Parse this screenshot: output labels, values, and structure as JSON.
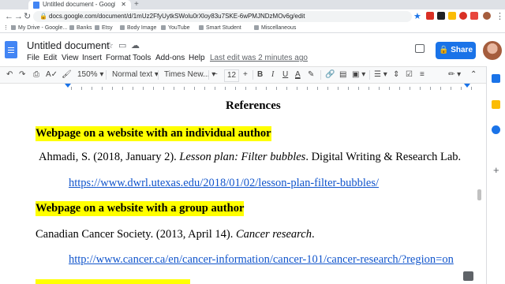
{
  "browser": {
    "tab_title": "Untitled document - Google D",
    "url": "docs.google.com/document/d/1mUz2FfyUytkSWolu0rXloy83u7SKE-6wPMJNDzMOv6g/edit",
    "bookmarks": [
      "My Drive - Google...",
      "Banks",
      "Etsy",
      "Body Image",
      "YouTube",
      "Smart Student",
      "Miscellaneous"
    ]
  },
  "doc": {
    "title": "Untitled document",
    "menu": [
      "File",
      "Edit",
      "View",
      "Insert",
      "Format",
      "Tools",
      "Add-ons",
      "Help"
    ],
    "last_edit": "Last edit was 2 minutes ago",
    "share_label": "Share"
  },
  "toolbar": {
    "zoom": "150%",
    "style": "Normal text",
    "font": "Times New...",
    "font_size": "12"
  },
  "content": {
    "heading": "References",
    "section1_title": "Webpage on a website with an individual author",
    "ref1_author": "Ahmadi, S. (2018, January 2). ",
    "ref1_title": "Lesson plan: Filter bubbles",
    "ref1_publisher": ". Digital Writing & Research Lab.",
    "ref1_url": "https://www.dwrl.utexas.edu/2018/01/02/lesson-plan-filter-bubbles/",
    "section2_title": "Webpage on a website with a group author",
    "ref2_author": "Canadian Cancer Society. (2013, April 14). ",
    "ref2_title": "Cancer research",
    "ref2_end": ".",
    "ref2_url": "http://www.cancer.ca/en/cancer-information/cancer-101/cancer-research/?region=on"
  }
}
